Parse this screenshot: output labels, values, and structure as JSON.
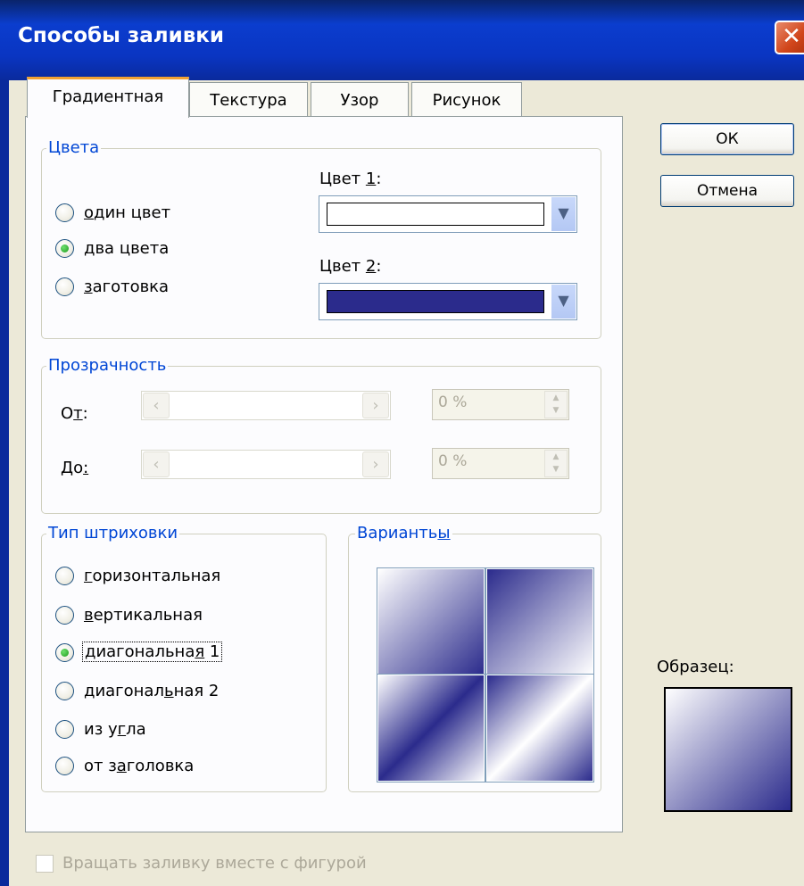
{
  "window": {
    "title": "Способы заливки",
    "close_symbol": "✕"
  },
  "tabs": [
    {
      "label": "Градиентная",
      "active": true
    },
    {
      "label": "Текстура",
      "active": false
    },
    {
      "label": "Узор",
      "active": false
    },
    {
      "label": "Рисунок",
      "active": false
    }
  ],
  "colors_group": {
    "legend": "Цвета",
    "options": [
      {
        "label": "один цвет",
        "checked": false
      },
      {
        "label": "два цвета",
        "checked": true
      },
      {
        "label": "заготовка",
        "checked": false
      }
    ],
    "color1": {
      "label": "Цвет 1:",
      "value": "#FFFFFF"
    },
    "color2": {
      "label": "Цвет 2:",
      "value": "#2B2B8C"
    }
  },
  "transparency_group": {
    "legend": "Прозрачность",
    "from_label": "От:",
    "to_label": "До:",
    "from_value": "0 %",
    "to_value": "0 %"
  },
  "shading_group": {
    "legend": "Тип штриховки",
    "options": [
      {
        "label": "горизонтальная",
        "checked": false
      },
      {
        "label": "вертикальная",
        "checked": false
      },
      {
        "label": "диагональная 1",
        "checked": true
      },
      {
        "label": "диагональная 2",
        "checked": false
      },
      {
        "label": "из угла",
        "checked": false
      },
      {
        "label": "от заголовка",
        "checked": false
      }
    ]
  },
  "variants_group": {
    "legend": "Варианты"
  },
  "buttons": {
    "ok": "ОК",
    "cancel": "Отмена"
  },
  "sample": {
    "label": "Образец:"
  },
  "rotate_checkbox": {
    "label": "Вращать заливку вместе с фигурой",
    "checked": false
  },
  "icons": {
    "dropdown": "chevron-down-icon",
    "left": "arrow-left-icon",
    "right": "arrow-right-icon"
  }
}
